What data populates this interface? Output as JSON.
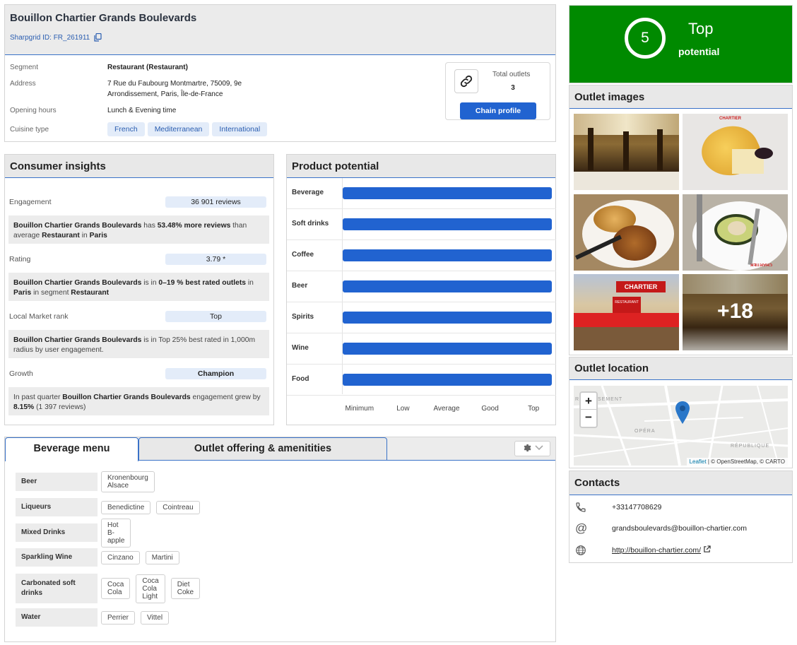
{
  "outlet": {
    "name": "Bouillon Chartier Grands Boulevards",
    "id_label": "Sharpgrid ID: FR_261911",
    "segment_label": "Segment",
    "segment_value": "Restaurant (Restaurant)",
    "address_label": "Address",
    "address_line1": "7 Rue du Faubourg Montmartre, 75009, 9e",
    "address_line2": "Arrondissement, Paris, Île-de-France",
    "hours_label": "Opening hours",
    "hours_value": "Lunch & Evening time",
    "cuisine_label": "Cuisine type",
    "cuisines": [
      "French",
      "Mediterranean",
      "International"
    ],
    "total_outlets_label": "Total outlets",
    "total_outlets_value": "3",
    "chain_profile_label": "Chain profile"
  },
  "score": {
    "value": "5",
    "line1": "Top",
    "line2": "potential",
    "color": "#008a00"
  },
  "consumer_insights": {
    "title": "Consumer insights",
    "engagement_label": "Engagement",
    "engagement_value": "36 901 reviews",
    "engagement_text": {
      "name": "Bouillon Chartier Grands Boulevards",
      "t1": " has ",
      "pct": "53.48% more reviews",
      "t2": " than average ",
      "segment": "Restaurant",
      "t3": " in ",
      "city": "Paris"
    },
    "rating_label": "Rating",
    "rating_value": "3.79 *",
    "rating_text": {
      "name": "Bouillon Chartier Grands Boulevards",
      "t1": " is in ",
      "pct": "0–19 % best rated outlets",
      "t2": " in ",
      "city": "Paris",
      "t3": " in segment  ",
      "segment": "Restaurant"
    },
    "rank_label": "Local Market rank",
    "rank_value": "Top",
    "rank_text": {
      "name": "Bouillon Chartier Grands Boulevards",
      "t1": " is in Top 25% best rated in 1,000m radius by user engagement."
    },
    "growth_label": "Growth",
    "growth_value": "Champion",
    "growth_text": {
      "t0": "In past quarter ",
      "name": "Bouillon Chartier Grands Boulevards",
      "t1": " engagement grew by ",
      "pct": "8.15%",
      "t2": " (1 397 reviews)"
    }
  },
  "product_potential": {
    "title": "Product potential",
    "bar_color": "#2163d0",
    "rows": [
      {
        "label": "Beverage",
        "level": 1.0
      },
      {
        "label": "Soft drinks",
        "level": 1.0
      },
      {
        "label": "Coffee",
        "level": 1.0
      },
      {
        "label": "Beer",
        "level": 1.0
      },
      {
        "label": "Spirits",
        "level": 1.0
      },
      {
        "label": "Wine",
        "level": 1.0
      },
      {
        "label": "Food",
        "level": 1.0
      }
    ],
    "scale": [
      "Minimum",
      "Low",
      "Average",
      "Good",
      "Top"
    ]
  },
  "tabs": {
    "beverage": "Beverage menu",
    "offering": "Outlet offering & amenitities"
  },
  "beverage_menu": [
    {
      "category": "Beer",
      "items": [
        "Kronenbourg Alsace"
      ]
    },
    {
      "category": "Liqueurs",
      "items": [
        "Benedictine",
        "Cointreau"
      ]
    },
    {
      "category": "Mixed Drinks",
      "items": [
        "Hot B-apple"
      ]
    },
    {
      "category": "Sparkling Wine",
      "items": [
        "Cinzano",
        "Martini"
      ]
    },
    {
      "category": "Carbonated soft drinks",
      "items": [
        "Coca Cola",
        "Coca Cola Light",
        "Diet Coke"
      ]
    },
    {
      "category": "Water",
      "items": [
        "Perrier",
        "Vittel"
      ]
    }
  ],
  "images": {
    "title": "Outlet images",
    "more_label": "+18",
    "signs": [
      "CHARTIER",
      "CHARTIER",
      "RESTAURANT"
    ]
  },
  "location": {
    "title": "Outlet location",
    "zoom_in": "+",
    "zoom_out": "−",
    "map_labels": [
      "RO",
      "SEMENT",
      "OPÉRA",
      "RÉPUBLIQUE"
    ],
    "leaflet": "Leaflet",
    "attribution": " | © OpenStreetMap, © CARTO"
  },
  "contacts": {
    "title": "Contacts",
    "phone": "+33147708629",
    "email": "grandsboulevards@bouillon-chartier.com",
    "website": "http://bouillon-chartier.com/"
  }
}
